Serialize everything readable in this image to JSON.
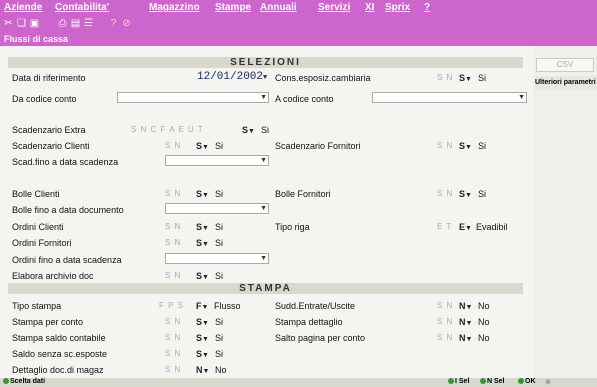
{
  "menu": {
    "items": [
      "Aziende",
      "Contabilita'",
      "Magazzino",
      "Stampe",
      "Annuali",
      "Servizi",
      "XI",
      "Sprix",
      "?"
    ]
  },
  "toolbar": {
    "icons": [
      "cut-icon",
      "copy-icon",
      "paste-icon",
      "print-icon",
      "list-icon",
      "help-icon",
      "erase-icon"
    ]
  },
  "window": {
    "title": "Flussi di cassa"
  },
  "selezioni": {
    "header": "SELEZIONI",
    "data_riferimento_label": "Data di riferimento",
    "data_riferimento_value": "12/01/2002",
    "cons_esposiz_label": "Cons.esposiz.cambiaria",
    "cons_esposiz_opts": "S N",
    "cons_esposiz_sel": "S",
    "cons_esposiz_val": "Si",
    "da_codice_label": "Da codice conto",
    "a_codice_label": "A codice conto",
    "scadenzario_extra_label": "Scadenzario Extra",
    "scadenzario_extra_opts": "S N C F A E U T",
    "scadenzario_extra_sel": "S",
    "scadenzario_extra_val": "Si",
    "scad_clienti_label": "Scadenzario Clienti",
    "scad_clienti_opts": "S N",
    "scad_clienti_sel": "S",
    "scad_clienti_val": "Si",
    "scad_fornitori_label": "Scadenzario Fornitori",
    "scad_fornitori_opts": "S N",
    "scad_fornitori_sel": "S",
    "scad_fornitori_val": "Si",
    "scad_fino_label": "Scad.fino a data scadenza",
    "bolle_clienti_label": "Bolle Clienti",
    "bolle_clienti_opts": "S N",
    "bolle_clienti_sel": "S",
    "bolle_clienti_val": "Si",
    "bolle_fornitori_label": "Bolle Fornitori",
    "bolle_fornitori_opts": "S N",
    "bolle_fornitori_sel": "S",
    "bolle_fornitori_val": "Si",
    "bolle_fino_label": "Bolle fino a data documento",
    "ordini_clienti_label": "Ordini Clienti",
    "ordini_clienti_opts": "S N",
    "ordini_clienti_sel": "S",
    "ordini_clienti_val": "Si",
    "tipo_riga_label": "Tipo riga",
    "tipo_riga_opts": "E T",
    "tipo_riga_sel": "E",
    "tipo_riga_val": "Evadibil",
    "ordini_fornitori_label": "Ordini Fornitori",
    "ordini_fornitori_opts": "S N",
    "ordini_fornitori_sel": "S",
    "ordini_fornitori_val": "Si",
    "ordini_fino_label": "Ordini fino a data scadenza",
    "elabora_label": "Elabora archivio doc",
    "elabora_opts": "S N",
    "elabora_sel": "S",
    "elabora_val": "Si"
  },
  "stampa": {
    "header": "STAMPA",
    "tipo_stampa_label": "Tipo stampa",
    "tipo_stampa_opts": "F P S",
    "tipo_stampa_sel": "F",
    "tipo_stampa_val": "Flusso",
    "sudd_label": "Sudd.Entrate/Uscite",
    "sudd_opts": "S N",
    "sudd_sel": "N",
    "sudd_val": "No",
    "per_conto_label": "Stampa per conto",
    "per_conto_opts": "S N",
    "per_conto_sel": "S",
    "per_conto_val": "Si",
    "dettaglio_label": "Stampa dettaglio",
    "dettaglio_opts": "S N",
    "dettaglio_sel": "N",
    "dettaglio_val": "No",
    "saldo_contabile_label": "Stampa saldo contabile",
    "saldo_contabile_opts": "S N",
    "saldo_contabile_sel": "S",
    "saldo_contabile_val": "Si",
    "salto_pagina_label": "Salto pagina per conto",
    "salto_pagina_opts": "S N",
    "salto_pagina_sel": "N",
    "salto_pagina_val": "No",
    "saldo_senza_label": "Saldo senza sc.esposte",
    "saldo_senza_opts": "S N",
    "saldo_senza_sel": "S",
    "saldo_senza_val": "Si",
    "dettaglio_doc_label": "Dettaglio doc.di magaz",
    "dettaglio_doc_opts": "S N",
    "dettaglio_doc_sel": "N",
    "dettaglio_doc_val": "No"
  },
  "side": {
    "csv_label": "CSV",
    "ulteriori_label": "Ulteriori parametri"
  },
  "status": {
    "left": "Scelta dati",
    "items": [
      "I Sel",
      "N Sel",
      "OK"
    ]
  },
  "colors": {
    "menubar": "#cc66cc",
    "section_header": "#d8d8cc",
    "accent_dot": "#2e9b2e"
  }
}
